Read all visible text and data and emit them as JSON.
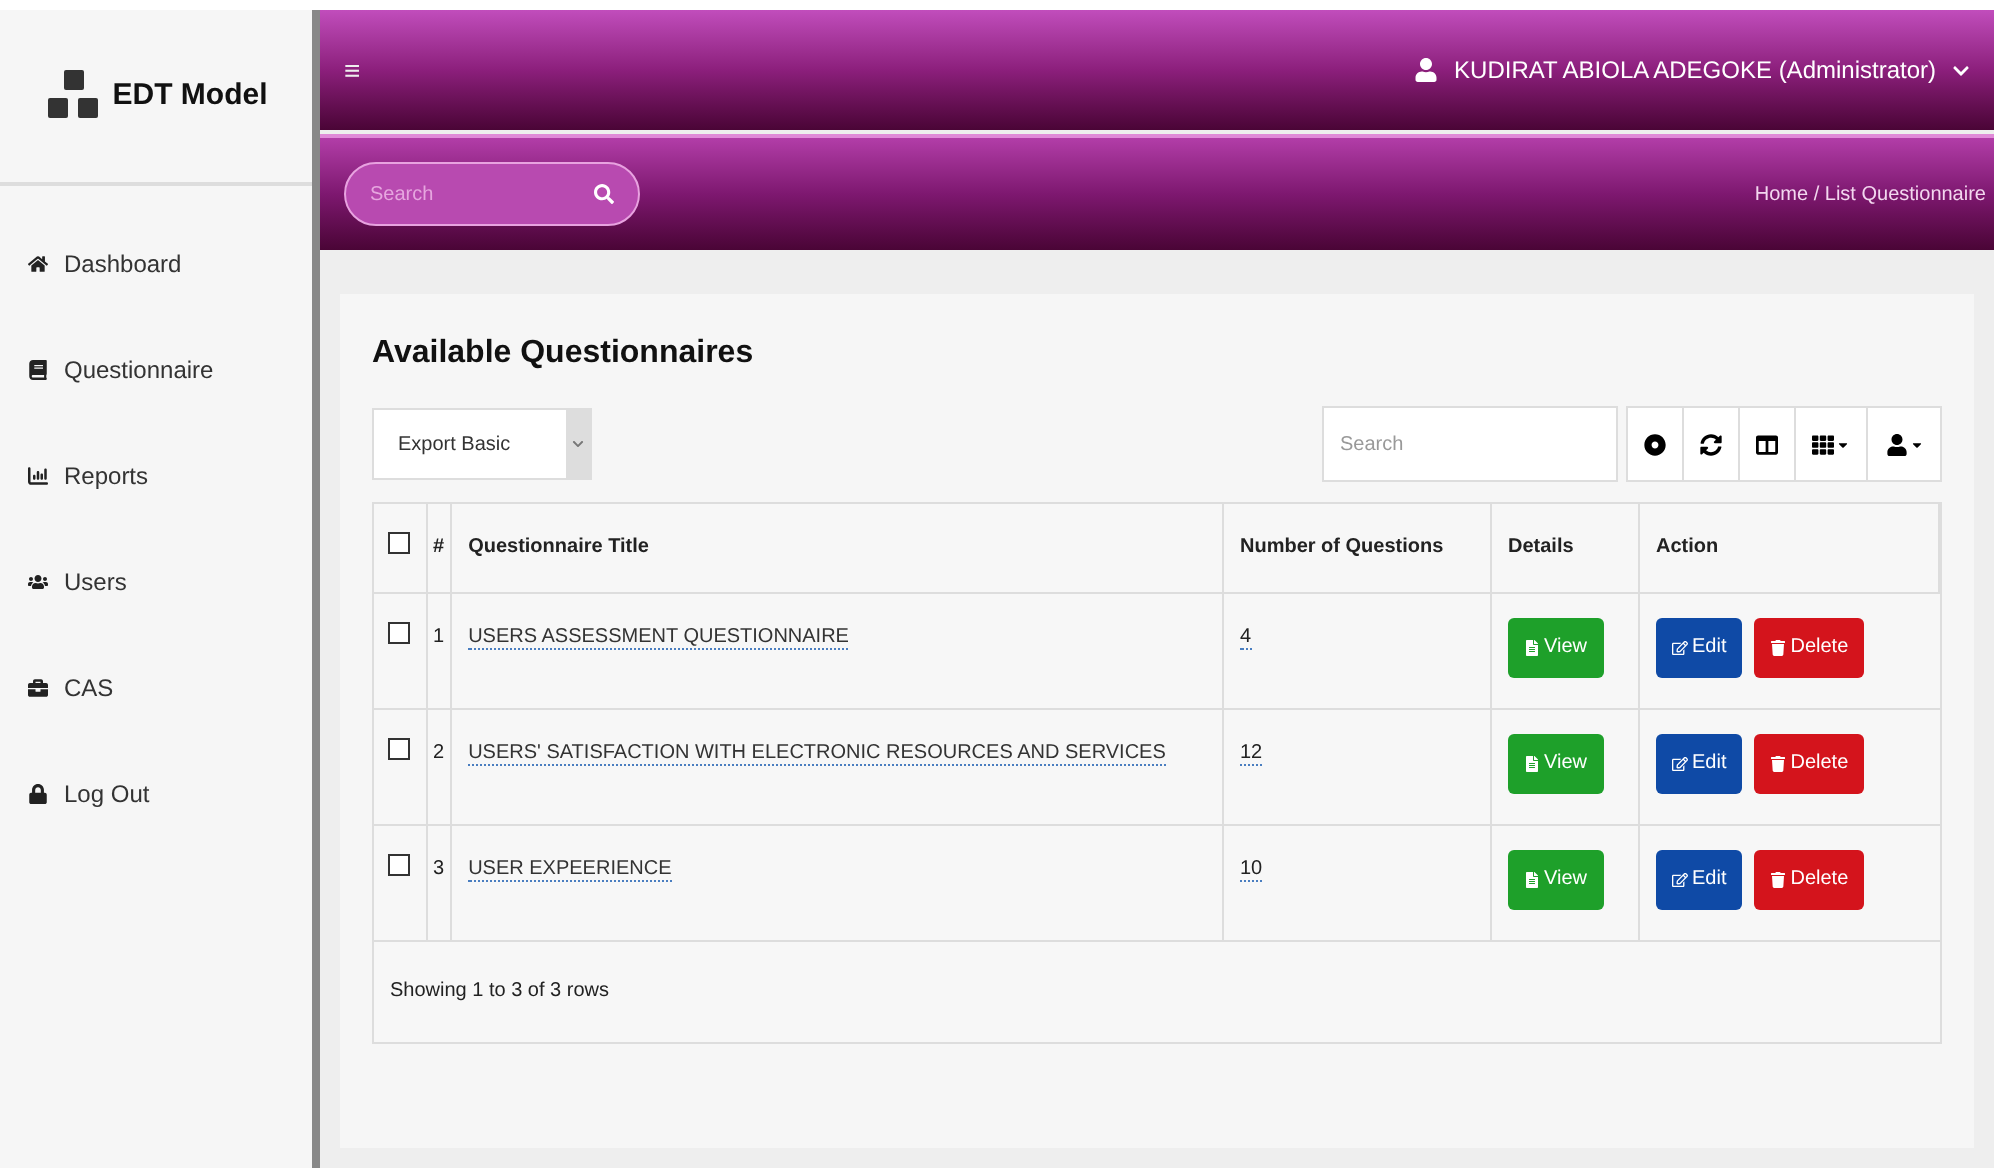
{
  "brand": {
    "name": "EDT Model"
  },
  "topbar": {
    "menu_glyph": "≡",
    "user": "KUDIRAT ABIOLA ADEGOKE (Administrator)"
  },
  "subbar": {
    "search": {
      "placeholder": "Search"
    },
    "breadcrumb": "Home / List Questionnaire"
  },
  "sidebar": {
    "items": [
      {
        "label": "Dashboard",
        "kind": "home"
      },
      {
        "label": "Questionnaire",
        "kind": "book"
      },
      {
        "label": "Reports",
        "kind": "chart"
      },
      {
        "label": "Users",
        "kind": "users"
      },
      {
        "label": "CAS",
        "kind": "briefcase"
      },
      {
        "label": "Log Out",
        "kind": "lock"
      }
    ]
  },
  "panel": {
    "title": "Available Questionnaires",
    "export": "Export Basic",
    "search": {
      "placeholder": "Search"
    }
  },
  "table": {
    "header_checked": false,
    "columns": [
      "#",
      "Questionnaire Title",
      "Number of Questions",
      "Details",
      "Action"
    ],
    "rows": [
      {
        "checked": false,
        "index": "1",
        "title": "USERS ASSESSMENT QUESTIONNAIRE",
        "count": "4",
        "view": "View",
        "edit": "Edit",
        "delete": "Delete"
      },
      {
        "checked": false,
        "index": "2",
        "title": "USERS' SATISFACTION WITH ELECTRONIC RESOURCES AND SERVICES",
        "count": "12",
        "view": "View",
        "edit": "Edit",
        "delete": "Delete"
      },
      {
        "checked": false,
        "index": "3",
        "title": "USER EXPEERIENCE",
        "count": "10",
        "view": "View",
        "edit": "Edit",
        "delete": "Delete"
      }
    ],
    "footer": "Showing 1 to 3 of 3 rows"
  }
}
